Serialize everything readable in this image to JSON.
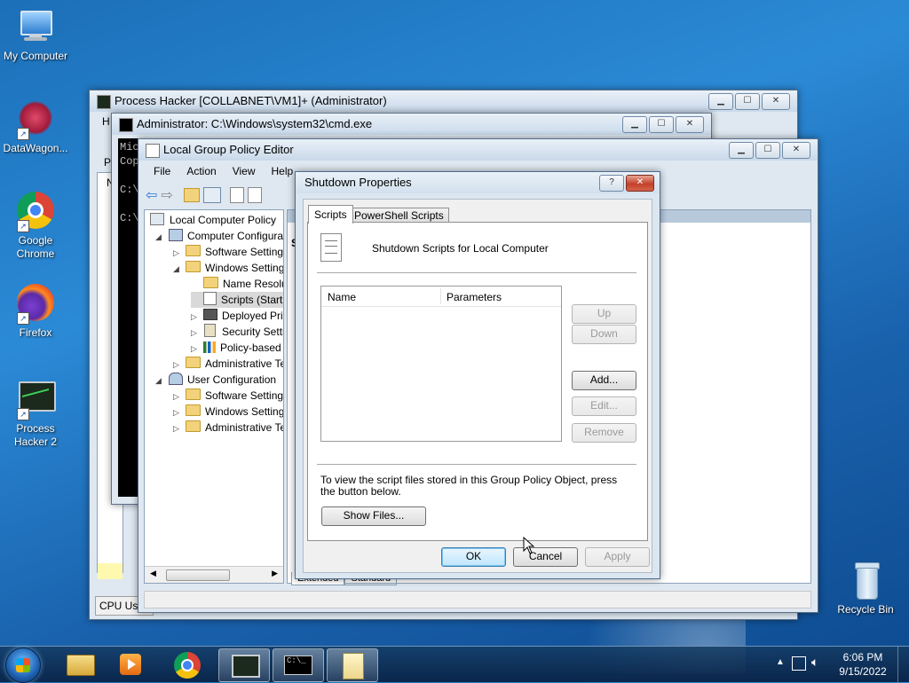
{
  "desktop": {
    "icons": [
      {
        "label": "My Computer"
      },
      {
        "label": "DataWagon..."
      },
      {
        "label": "Google Chrome"
      },
      {
        "label": "Firefox"
      },
      {
        "label": "Process Hacker 2"
      },
      {
        "label": "Recycle Bin"
      }
    ]
  },
  "process_hacker": {
    "title": "Process Hacker [COLLABNET\\VM1]+ (Administrator)",
    "menu_partial": "H",
    "tab_partial": "Pr",
    "tb_partial": "N",
    "status": "CPU Usa"
  },
  "cmd": {
    "title": "Administrator: C:\\Windows\\system32\\cmd.exe",
    "lines": [
      "Mic",
      "Cop",
      "C:\\",
      "C:\\"
    ]
  },
  "gpe": {
    "title": "Local Group Policy Editor",
    "menu": [
      "File",
      "Action",
      "View",
      "Help"
    ],
    "tree": [
      {
        "label": "Local Computer Policy"
      },
      {
        "label": "Computer Configura"
      },
      {
        "label": "Software Settings"
      },
      {
        "label": "Windows Setting"
      },
      {
        "label": "Name Resolu"
      },
      {
        "label": "Scripts (Startu"
      },
      {
        "label": "Deployed Pri"
      },
      {
        "label": "Security Settin"
      },
      {
        "label": "Policy-based"
      },
      {
        "label": "Administrative Te"
      },
      {
        "label": "User Configuration"
      },
      {
        "label": "Software Settings"
      },
      {
        "label": "Windows Setting"
      },
      {
        "label": "Administrative Te"
      }
    ],
    "right_partial": "S",
    "tabs_bottom": [
      "Extended",
      "Standard"
    ]
  },
  "dialog": {
    "title": "Shutdown Properties",
    "tabs": [
      "Scripts",
      "PowerShell Scripts"
    ],
    "heading": "Shutdown Scripts for Local Computer",
    "columns": [
      "Name",
      "Parameters"
    ],
    "buttons": {
      "up": "Up",
      "down": "Down",
      "add": "Add...",
      "edit": "Edit...",
      "remove": "Remove",
      "show_files": "Show Files...",
      "ok": "OK",
      "cancel": "Cancel",
      "apply": "Apply"
    },
    "info_line1": "To view the script files stored in this Group Policy Object, press",
    "info_line2": "the button below."
  },
  "taskbar": {
    "time": "6:06 PM",
    "date": "9/15/2022"
  }
}
